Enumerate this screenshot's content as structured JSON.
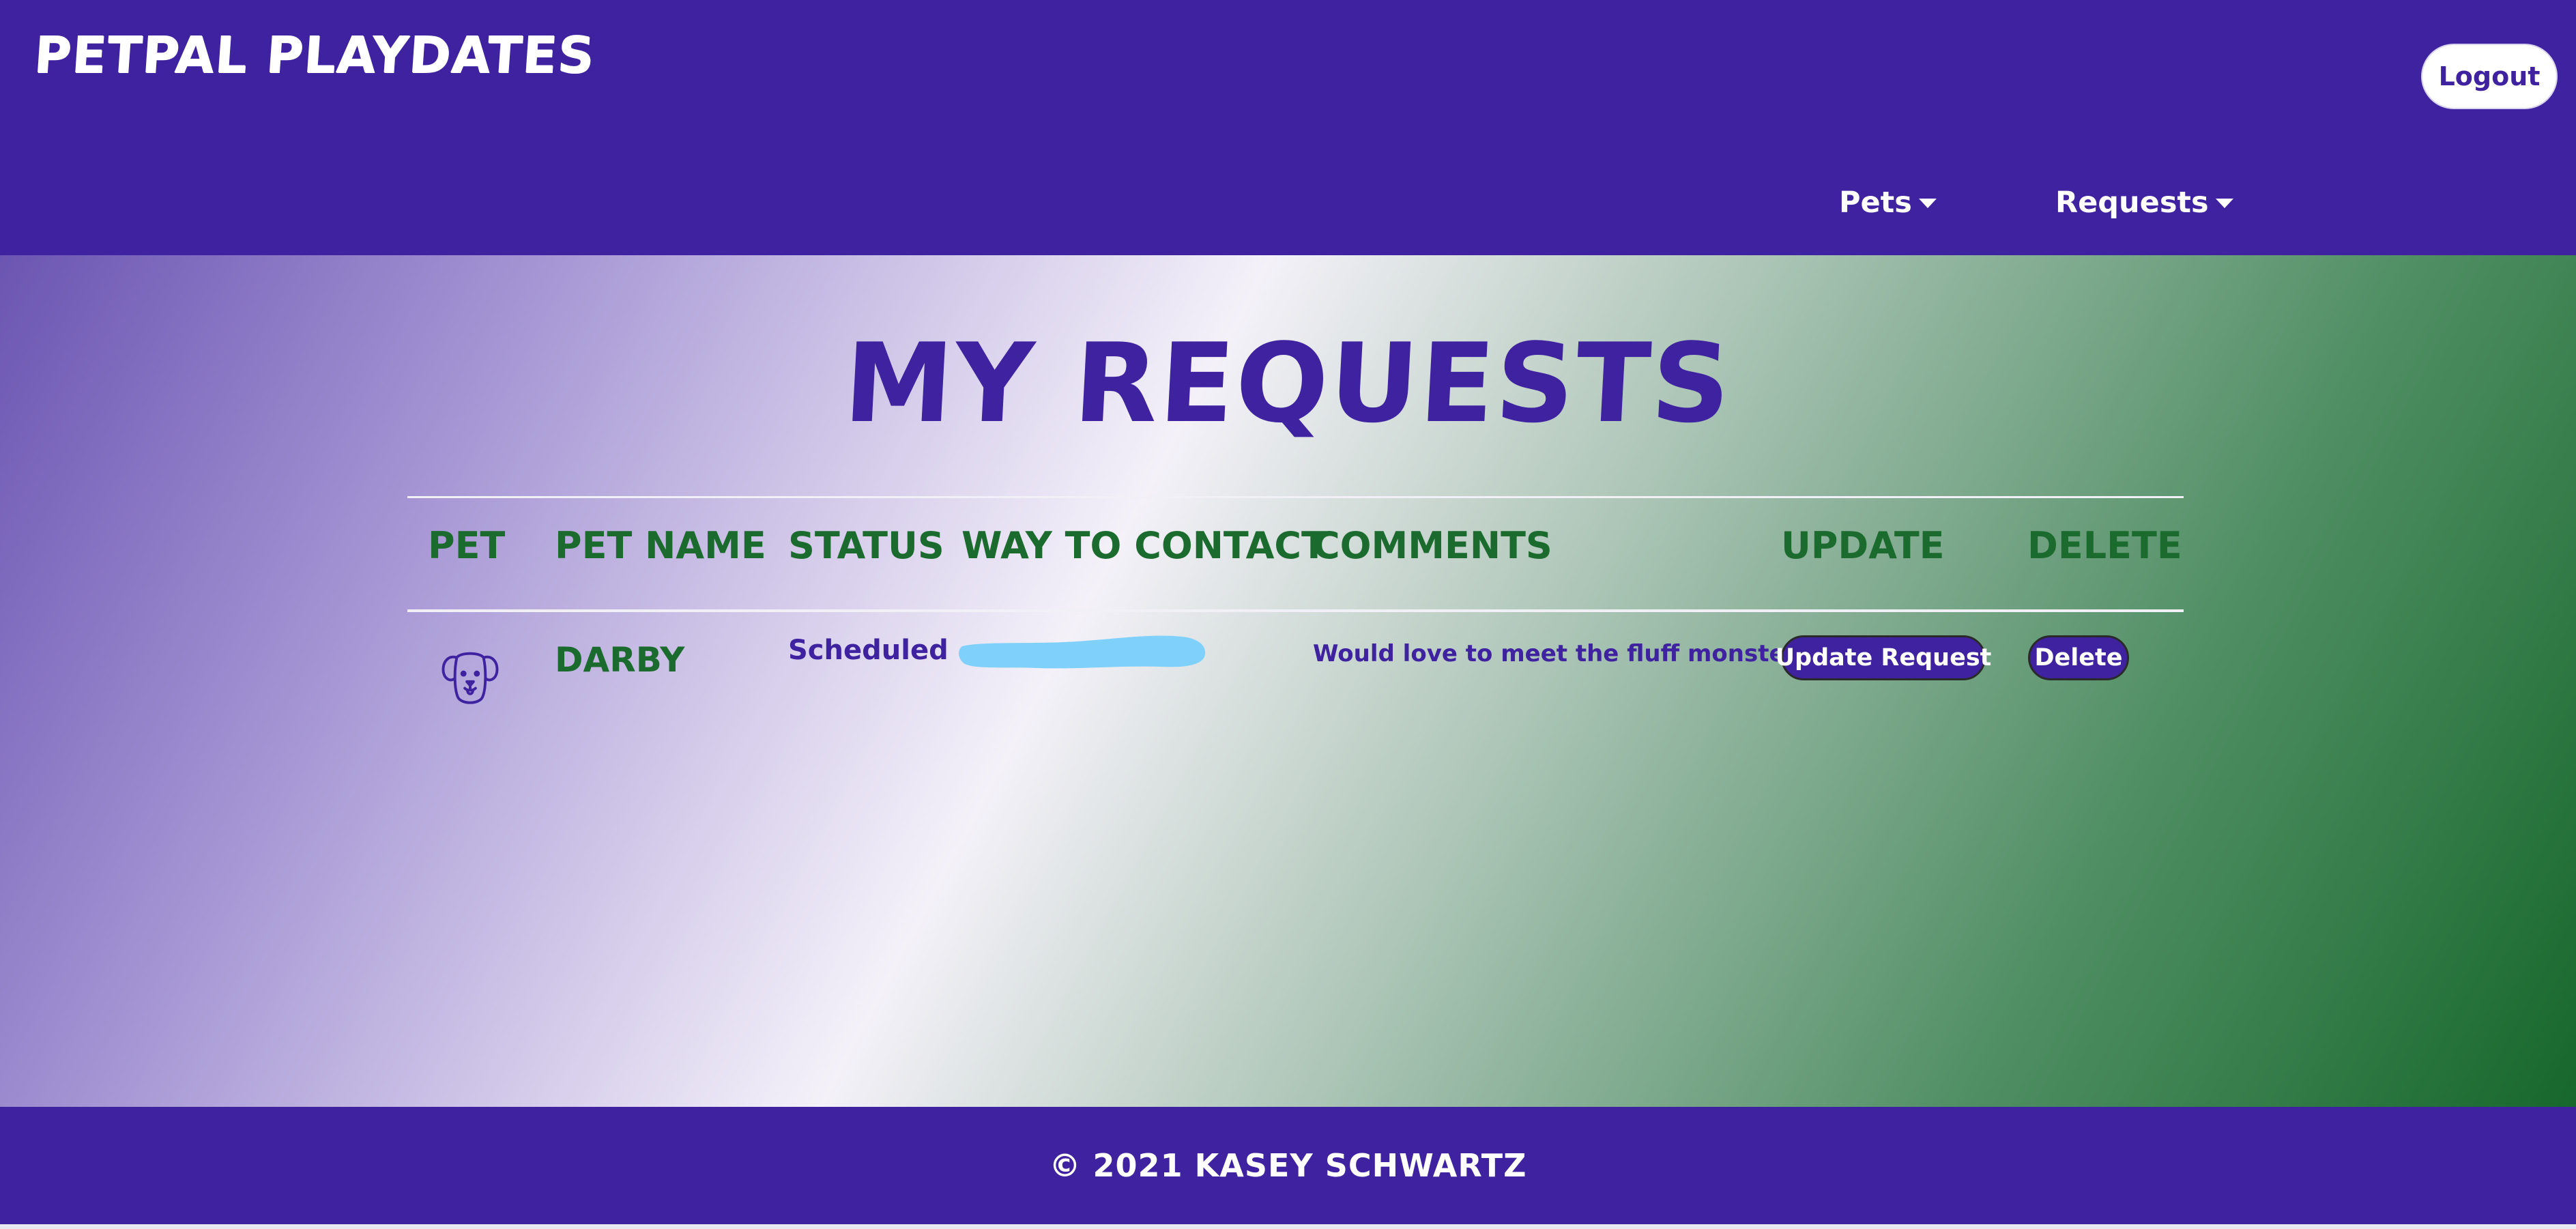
{
  "colors": {
    "brand_purple": "#3e22a0",
    "heading_green": "#1c6b2e",
    "white": "#ffffff",
    "redaction_blue": "#7fd1fb"
  },
  "header": {
    "brand": "PetPal Playdates",
    "logout_label": "Logout",
    "nav": [
      {
        "label": "Pets",
        "icon": "caret-down-icon"
      },
      {
        "label": "Requests",
        "icon": "caret-down-icon"
      }
    ]
  },
  "main": {
    "title": "My Requests",
    "table": {
      "headers": [
        "Pet",
        "Pet Name",
        "Status",
        "Way to Contact",
        "Comments",
        "Update",
        "Delete"
      ],
      "rows": [
        {
          "pet_icon": "dog-icon",
          "pet_name": "DARBY",
          "status": "Scheduled",
          "contact": "",
          "comments": "Would love to meet the fluff monster!",
          "update_label": "Update Request",
          "delete_label": "Delete"
        }
      ]
    }
  },
  "footer": {
    "text": "© 2021 Kasey Schwartz"
  }
}
